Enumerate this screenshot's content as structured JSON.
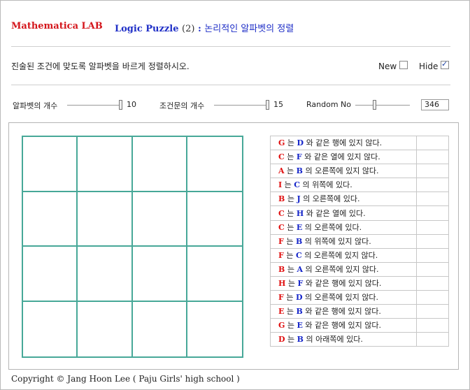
{
  "header": {
    "brand": "Mathematica LAB",
    "puzzle_title": "Logic Puzzle",
    "puzzle_num": "(2)",
    "puzzle_sep": ":",
    "puzzle_subtitle": "논리적인 알파벳의 정렬"
  },
  "instruction": "진술된 조건에 맞도록 알파벳을 바르게 정렬하시오.",
  "controls": {
    "new_label": "New",
    "new_checked": false,
    "hide_label": "Hide",
    "hide_checked": true
  },
  "sliders": [
    {
      "label": "알파벳의 개수",
      "value": "10",
      "level": 1.0
    },
    {
      "label": "조건문의 개수",
      "value": "15",
      "level": 1.0
    },
    {
      "label": "Random No",
      "value": "346",
      "level": 0.35
    }
  ],
  "grid": {
    "rows": 4,
    "cols": 4
  },
  "clues": [
    {
      "a": "G",
      "b": "D",
      "text": "와 같은 행에 있지 않다."
    },
    {
      "a": "C",
      "b": "F",
      "text": "와 같은 열에 있지 않다."
    },
    {
      "a": "A",
      "b": "B",
      "text": "의 오른쪽에 있지 않다."
    },
    {
      "a": "I",
      "b": "C",
      "text": "의 위쪽에 있다."
    },
    {
      "a": "B",
      "b": "J",
      "text": "의 오른쪽에 있다."
    },
    {
      "a": "C",
      "b": "H",
      "text": "와 같은 열에 있다."
    },
    {
      "a": "C",
      "b": "E",
      "text": "의 오른쪽에 있다."
    },
    {
      "a": "F",
      "b": "B",
      "text": "의 위쪽에 있지 않다."
    },
    {
      "a": "F",
      "b": "C",
      "text": "의 오른쪽에 있지 않다."
    },
    {
      "a": "B",
      "b": "A",
      "text": "의 오른쪽에 있지 않다."
    },
    {
      "a": "H",
      "b": "F",
      "text": "와 같은 행에 있지 않다."
    },
    {
      "a": "F",
      "b": "D",
      "text": "의 오른쪽에 있지 않다."
    },
    {
      "a": "E",
      "b": "B",
      "text": "와 같은 행에 있지 않다."
    },
    {
      "a": "G",
      "b": "E",
      "text": "와 같은 행에 있지 않다."
    },
    {
      "a": "D",
      "b": "B",
      "text": "의 아래쪽에 있다."
    }
  ],
  "clue_connector": "는",
  "footer": "Copyright © Jang Hoon Lee ( Paju Girls' high school )",
  "colors": {
    "grid": "#47a898",
    "brand": "#d4151b",
    "title": "#1f2fc7"
  }
}
